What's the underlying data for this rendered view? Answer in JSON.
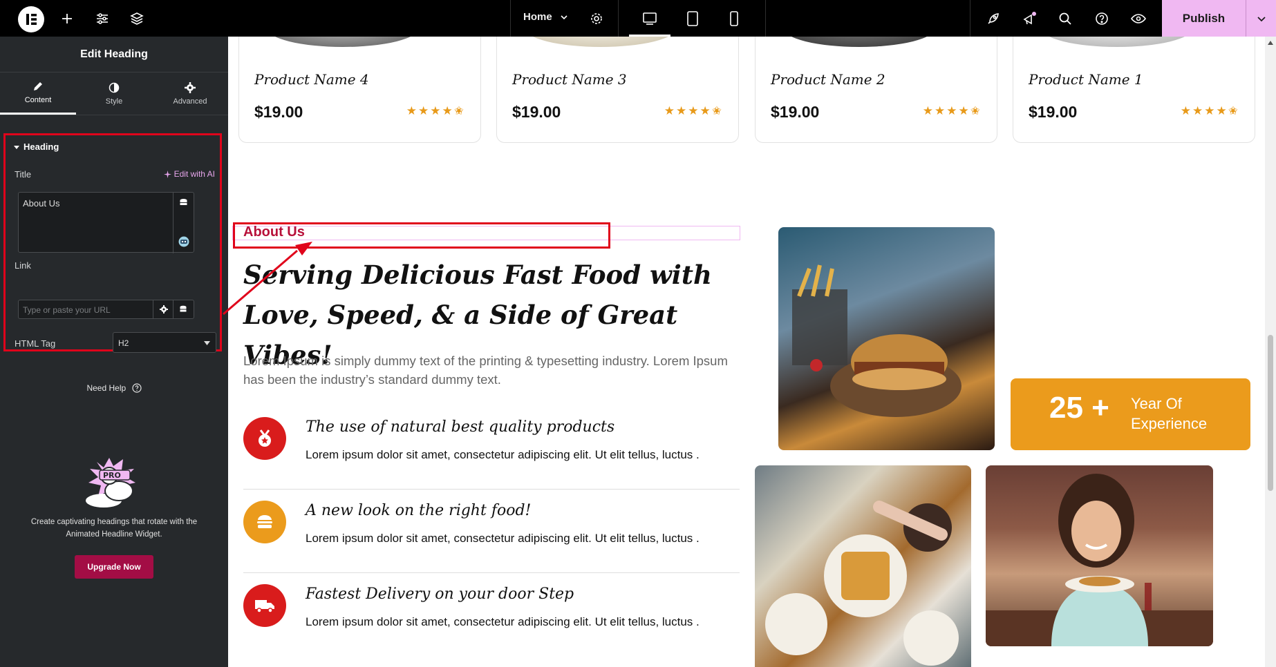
{
  "topbar": {
    "page_name": "Home",
    "publish_label": "Publish",
    "icons": [
      "elementor-logo-icon",
      "add-icon",
      "settings-sliders-icon",
      "layers-icon",
      "page-settings-icon",
      "desktop-icon",
      "tablet-icon",
      "mobile-icon",
      "rocket-icon",
      "notifications-icon",
      "search-icon",
      "help-icon",
      "preview-eye-icon",
      "chevron-down-icon"
    ]
  },
  "panel": {
    "title": "Edit Heading",
    "tabs": [
      {
        "label": "Content"
      },
      {
        "label": "Style"
      },
      {
        "label": "Advanced"
      }
    ],
    "section_title": "Heading",
    "title_label": "Title",
    "edit_ai": "Edit with AI",
    "title_value": "About Us",
    "link_label": "Link",
    "link_placeholder": "Type or paste your URL",
    "html_tag_label": "HTML Tag",
    "html_tag_value": "H2",
    "need_help": "Need Help",
    "promo_text": "Create captivating headings that rotate with the Animated Headline Widget.",
    "upgrade_label": "Upgrade Now"
  },
  "products": [
    {
      "name": "Product Name 4",
      "price": "$19.00",
      "rating": 4.5
    },
    {
      "name": "Product Name 3",
      "price": "$19.00",
      "rating": 4.5
    },
    {
      "name": "Product Name 2",
      "price": "$19.00",
      "rating": 4.5
    },
    {
      "name": "Product Name 1",
      "price": "$19.00",
      "rating": 4.5
    }
  ],
  "about": {
    "label": "About Us",
    "heading": "Serving Delicious Fast Food with Love, Speed, & a Side of Great Vibes!",
    "intro": "Lorem Ipsum is simply dummy text of the printing & typesetting industry. Lorem Ipsum has been the industry’s standard dummy text."
  },
  "features": [
    {
      "title": "The use of natural best quality products",
      "desc": "Lorem ipsum dolor sit amet, consectetur adipiscing elit. Ut elit tellus, luctus .",
      "color": "#d91c1c",
      "icon": "medal-icon"
    },
    {
      "title": "A new look on the right food!",
      "desc": "Lorem ipsum dolor sit amet, consectetur adipiscing elit. Ut elit tellus, luctus .",
      "color": "#eb9b1c",
      "icon": "burger-icon"
    },
    {
      "title": "Fastest Delivery on your door Step",
      "desc": "Lorem ipsum dolor sit amet, consectetur adipiscing elit. Ut elit tellus, luctus .",
      "color": "#d91c1c",
      "icon": "truck-icon"
    }
  ],
  "experience": {
    "number": "25 +",
    "label": "Year Of Experience"
  },
  "colors": {
    "accent": "#f0b8f2",
    "brand_red": "#b8103a",
    "orange": "#eb9b1c",
    "highlight": "#e0041b"
  }
}
